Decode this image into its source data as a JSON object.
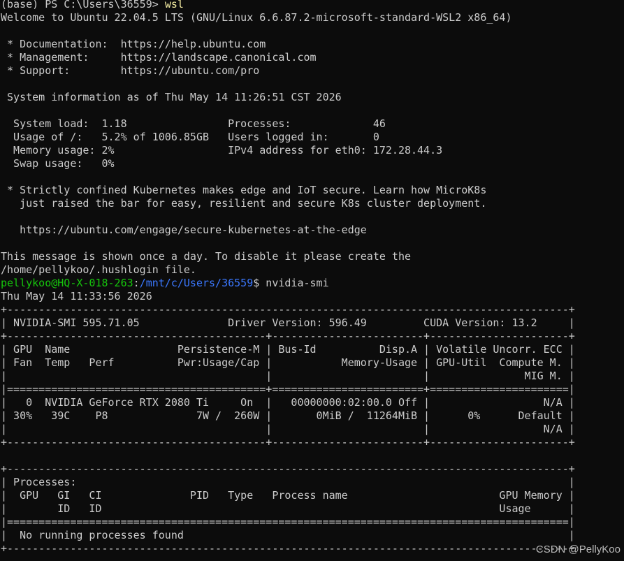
{
  "colors": {
    "background": "#0c0c0c",
    "foreground": "#cccccc",
    "command": "#f9f1a5",
    "user_host": "#16c60c",
    "path": "#3b78ff"
  },
  "terminal": {
    "lines": [
      [
        {
          "t": "(base) PS C:\\Users\\36559> ",
          "c": "default"
        },
        {
          "t": "wsl",
          "c": "cmd"
        }
      ],
      [
        {
          "t": "Welcome to Ubuntu 22.04.5 LTS (GNU/Linux 6.6.87.2-microsoft-standard-WSL2 x86_64)",
          "c": "default"
        }
      ],
      [
        {
          "t": "",
          "c": "default"
        }
      ],
      [
        {
          "t": " * Documentation:  https://help.ubuntu.com",
          "c": "default"
        }
      ],
      [
        {
          "t": " * Management:     https://landscape.canonical.com",
          "c": "default"
        }
      ],
      [
        {
          "t": " * Support:        https://ubuntu.com/pro",
          "c": "default"
        }
      ],
      [
        {
          "t": "",
          "c": "default"
        }
      ],
      [
        {
          "t": " System information as of Thu May 14 11:26:51 CST 2026",
          "c": "default"
        }
      ],
      [
        {
          "t": "",
          "c": "default"
        }
      ],
      [
        {
          "t": "  System load:  1.18                Processes:             46",
          "c": "default"
        }
      ],
      [
        {
          "t": "  Usage of /:   5.2% of 1006.85GB   Users logged in:       0",
          "c": "default"
        }
      ],
      [
        {
          "t": "  Memory usage: 2%                  IPv4 address for eth0: 172.28.44.3",
          "c": "default"
        }
      ],
      [
        {
          "t": "  Swap usage:   0%",
          "c": "default"
        }
      ],
      [
        {
          "t": "",
          "c": "default"
        }
      ],
      [
        {
          "t": " * Strictly confined Kubernetes makes edge and IoT secure. Learn how MicroK8s",
          "c": "default"
        }
      ],
      [
        {
          "t": "   just raised the bar for easy, resilient and secure K8s cluster deployment.",
          "c": "default"
        }
      ],
      [
        {
          "t": "",
          "c": "default"
        }
      ],
      [
        {
          "t": "   https://ubuntu.com/engage/secure-kubernetes-at-the-edge",
          "c": "default"
        }
      ],
      [
        {
          "t": "",
          "c": "default"
        }
      ],
      [
        {
          "t": "This message is shown once a day. To disable it please create the",
          "c": "default"
        }
      ],
      [
        {
          "t": "/home/pellykoo/.hushlogin file.",
          "c": "default"
        }
      ],
      [
        {
          "t": "pellykoo@HQ-X-018-263",
          "c": "user"
        },
        {
          "t": ":",
          "c": "default"
        },
        {
          "t": "/mnt/c/Users/36559",
          "c": "path"
        },
        {
          "t": "$ nvidia-smi",
          "c": "default"
        }
      ],
      [
        {
          "t": "Thu May 14 11:33:56 2026",
          "c": "default"
        }
      ],
      [
        {
          "t": "+-----------------------------------------------------------------------------------------+",
          "c": "default"
        }
      ],
      [
        {
          "t": "| NVIDIA-SMI 595.71.05              Driver Version: 596.49         CUDA Version: 13.2     |",
          "c": "default"
        }
      ],
      [
        {
          "t": "+-----------------------------------------+------------------------+----------------------+",
          "c": "default"
        }
      ],
      [
        {
          "t": "| GPU  Name                 Persistence-M | Bus-Id          Disp.A | Volatile Uncorr. ECC |",
          "c": "default"
        }
      ],
      [
        {
          "t": "| Fan  Temp   Perf          Pwr:Usage/Cap |           Memory-Usage | GPU-Util  Compute M. |",
          "c": "default"
        }
      ],
      [
        {
          "t": "|                                         |                        |               MIG M. |",
          "c": "default"
        }
      ],
      [
        {
          "t": "|=========================================+========================+======================|",
          "c": "default"
        }
      ],
      [
        {
          "t": "|   0  NVIDIA GeForce RTX 2080 Ti     On  |   00000000:02:00.0 Off |                  N/A |",
          "c": "default"
        }
      ],
      [
        {
          "t": "| 30%   39C    P8              7W /  260W |       0MiB /  11264MiB |      0%      Default |",
          "c": "default"
        }
      ],
      [
        {
          "t": "|                                         |                        |                  N/A |",
          "c": "default"
        }
      ],
      [
        {
          "t": "+-----------------------------------------+------------------------+----------------------+",
          "c": "default"
        }
      ],
      [
        {
          "t": "",
          "c": "default"
        }
      ],
      [
        {
          "t": "+-----------------------------------------------------------------------------------------+",
          "c": "default"
        }
      ],
      [
        {
          "t": "| Processes:                                                                              |",
          "c": "default"
        }
      ],
      [
        {
          "t": "|  GPU   GI   CI              PID   Type   Process name                        GPU Memory |",
          "c": "default"
        }
      ],
      [
        {
          "t": "|        ID   ID                                                               Usage      |",
          "c": "default"
        }
      ],
      [
        {
          "t": "|=========================================================================================|",
          "c": "default"
        }
      ],
      [
        {
          "t": "|  No running processes found                                                             |",
          "c": "default"
        }
      ],
      [
        {
          "t": "+-----------------------------------------------------------------------------------------+",
          "c": "default"
        }
      ]
    ]
  },
  "watermark": "CSDN @PellyKoo"
}
